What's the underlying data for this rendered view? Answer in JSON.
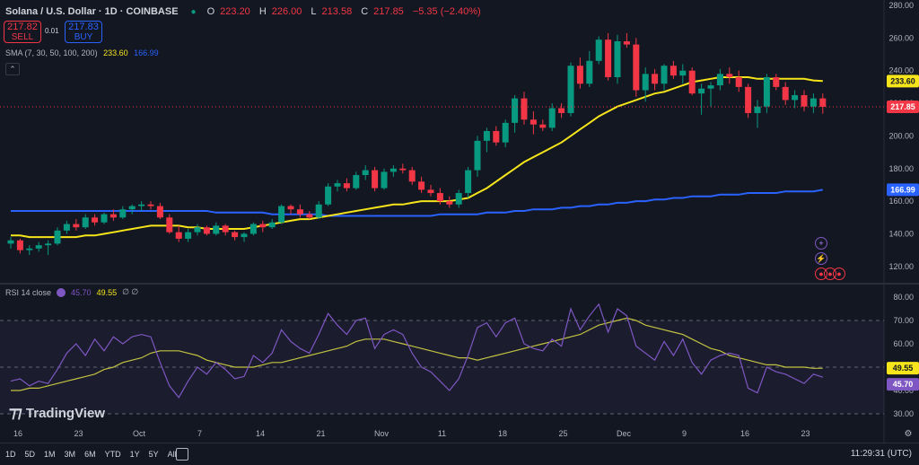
{
  "header": {
    "symbol": "Solana / U.S. Dollar · 1D · COINBASE",
    "open_label": "O",
    "open": "223.20",
    "high_label": "H",
    "high": "226.00",
    "low_label": "L",
    "low": "213.58",
    "close_label": "C",
    "close": "217.85",
    "change": "−5.35 (−2.40%)"
  },
  "trade": {
    "sell_price": "217.82",
    "sell_label": "SELL",
    "spread": "0.01",
    "buy_price": "217.83",
    "buy_label": "BUY"
  },
  "sma_legend": {
    "label": "SMA (7, 30, 50, 100, 200)",
    "v1": "233.60",
    "v2": "166.99"
  },
  "rsi_legend": {
    "label": "RSI 14 close",
    "v1": "45.70",
    "v2": "49.55",
    "extra": "∅ ∅"
  },
  "brand": "TradingView",
  "periods": [
    "1D",
    "5D",
    "1M",
    "3M",
    "6M",
    "YTD",
    "1Y",
    "5Y",
    "All"
  ],
  "clock": "11:29:31 (UTC)",
  "colors": {
    "bg": "#131722",
    "up": "#089981",
    "down": "#f23645",
    "sma_fast": "#f5e51a",
    "sma_slow": "#2962ff",
    "rsi": "#7e57c2",
    "rsi_ma": "#c3c341"
  },
  "chart_data": [
    {
      "type": "candlestick",
      "title": "Solana / U.S. Dollar · 1D · COINBASE",
      "ylim": [
        110,
        280
      ],
      "y_ticks": [
        120,
        140,
        160,
        180,
        200,
        220,
        240,
        260,
        280
      ],
      "x_tick_labels": [
        "16",
        "23",
        "Oct",
        "7",
        "14",
        "21",
        "Nov",
        "11",
        "18",
        "25",
        "Dec",
        "9",
        "16",
        "23"
      ],
      "candles": [
        [
          134,
          138,
          131,
          136
        ],
        [
          136,
          137,
          128,
          130
        ],
        [
          130,
          133,
          127,
          131
        ],
        [
          131,
          135,
          129,
          133
        ],
        [
          133,
          136,
          127,
          134
        ],
        [
          134,
          144,
          133,
          142
        ],
        [
          142,
          148,
          140,
          146
        ],
        [
          146,
          149,
          142,
          144
        ],
        [
          144,
          152,
          143,
          150
        ],
        [
          150,
          152,
          145,
          147
        ],
        [
          147,
          153,
          146,
          152
        ],
        [
          152,
          155,
          148,
          150
        ],
        [
          150,
          157,
          149,
          155
        ],
        [
          155,
          158,
          152,
          157
        ],
        [
          157,
          160,
          154,
          158
        ],
        [
          158,
          160,
          155,
          157
        ],
        [
          157,
          159,
          149,
          150
        ],
        [
          150,
          152,
          140,
          141
        ],
        [
          141,
          145,
          135,
          137
        ],
        [
          137,
          143,
          135,
          141
        ],
        [
          141,
          146,
          139,
          144
        ],
        [
          144,
          145,
          139,
          140
        ],
        [
          140,
          147,
          139,
          145
        ],
        [
          145,
          146,
          139,
          141
        ],
        [
          141,
          142,
          136,
          138
        ],
        [
          138,
          141,
          135,
          140
        ],
        [
          140,
          147,
          139,
          146
        ],
        [
          146,
          148,
          141,
          144
        ],
        [
          144,
          149,
          143,
          147
        ],
        [
          147,
          158,
          146,
          157
        ],
        [
          157,
          158,
          152,
          155
        ],
        [
          155,
          158,
          150,
          152
        ],
        [
          152,
          154,
          149,
          150
        ],
        [
          150,
          160,
          149,
          158
        ],
        [
          158,
          171,
          157,
          169
        ],
        [
          169,
          173,
          166,
          171
        ],
        [
          171,
          174,
          166,
          168
        ],
        [
          168,
          178,
          167,
          176
        ],
        [
          176,
          182,
          173,
          179
        ],
        [
          179,
          181,
          166,
          168
        ],
        [
          168,
          180,
          167,
          178
        ],
        [
          178,
          182,
          175,
          180
        ],
        [
          180,
          183,
          177,
          179
        ],
        [
          179,
          181,
          170,
          172
        ],
        [
          172,
          175,
          165,
          167
        ],
        [
          167,
          170,
          163,
          165
        ],
        [
          165,
          168,
          158,
          160
        ],
        [
          160,
          163,
          156,
          158
        ],
        [
          158,
          167,
          156,
          165
        ],
        [
          165,
          181,
          162,
          179
        ],
        [
          179,
          200,
          175,
          197
        ],
        [
          197,
          205,
          190,
          203
        ],
        [
          203,
          206,
          194,
          196
        ],
        [
          196,
          210,
          193,
          208
        ],
        [
          208,
          225,
          202,
          223
        ],
        [
          223,
          227,
          207,
          210
        ],
        [
          210,
          215,
          201,
          207
        ],
        [
          207,
          210,
          203,
          205
        ],
        [
          205,
          220,
          203,
          217
        ],
        [
          217,
          220,
          211,
          214
        ],
        [
          214,
          245,
          212,
          243
        ],
        [
          243,
          248,
          229,
          232
        ],
        [
          232,
          252,
          230,
          246
        ],
        [
          246,
          261,
          244,
          259
        ],
        [
          259,
          263,
          234,
          236
        ],
        [
          236,
          262,
          232,
          258
        ],
        [
          258,
          263,
          254,
          256
        ],
        [
          256,
          260,
          224,
          228
        ],
        [
          228,
          242,
          221,
          238
        ],
        [
          238,
          241,
          228,
          232
        ],
        [
          232,
          244,
          228,
          243
        ],
        [
          243,
          246,
          235,
          237
        ],
        [
          237,
          244,
          232,
          240
        ],
        [
          240,
          242,
          225,
          226
        ],
        [
          226,
          232,
          213,
          229
        ],
        [
          229,
          233,
          218,
          231
        ],
        [
          231,
          241,
          228,
          238
        ],
        [
          238,
          242,
          232,
          236
        ],
        [
          236,
          240,
          227,
          230
        ],
        [
          230,
          232,
          211,
          214
        ],
        [
          214,
          222,
          205,
          218
        ],
        [
          218,
          238,
          214,
          236
        ],
        [
          236,
          238,
          228,
          230
        ],
        [
          230,
          233,
          219,
          222
        ],
        [
          222,
          228,
          217,
          225
        ],
        [
          225,
          228,
          215,
          218
        ],
        [
          218,
          226,
          214,
          223
        ],
        [
          223,
          226,
          213.58,
          217.85
        ]
      ],
      "series": [
        {
          "name": "SMA",
          "last": 233.6,
          "values": [
            139,
            139,
            138,
            138,
            138,
            138,
            138,
            138,
            139,
            139,
            140,
            141,
            142,
            143,
            144,
            145,
            145,
            145,
            145,
            144,
            144,
            143,
            143,
            143,
            143,
            143,
            144,
            145,
            146,
            147,
            148,
            149,
            149,
            150,
            151,
            152,
            153,
            154,
            155,
            156,
            157,
            158,
            158,
            159,
            160,
            160,
            160,
            160,
            161,
            162,
            165,
            168,
            172,
            176,
            180,
            184,
            187,
            190,
            193,
            196,
            200,
            204,
            208,
            212,
            215,
            218,
            220,
            222,
            224,
            226,
            227,
            229,
            231,
            233,
            234,
            235,
            236,
            236,
            236,
            236,
            235,
            235,
            235,
            235,
            235,
            235,
            234,
            233.6
          ]
        },
        {
          "name": "SMA",
          "last": 166.99,
          "values": [
            154,
            154,
            154,
            154,
            154,
            154,
            154,
            154,
            154,
            154,
            154,
            154,
            154,
            154,
            154,
            154,
            154,
            154,
            154,
            154,
            154,
            154,
            153,
            153,
            153,
            153,
            153,
            153,
            152,
            152,
            152,
            152,
            152,
            152,
            151,
            151,
            151,
            151,
            151,
            151,
            151,
            151,
            151,
            151,
            151,
            151,
            152,
            152,
            152,
            152,
            152,
            153,
            153,
            153,
            154,
            154,
            155,
            155,
            155,
            156,
            156,
            157,
            157,
            158,
            158,
            159,
            159,
            160,
            160,
            161,
            161,
            162,
            162,
            163,
            163,
            163,
            164,
            164,
            164,
            165,
            165,
            165,
            165,
            166,
            166,
            166,
            166,
            166.99
          ]
        }
      ],
      "price_labels": [
        "233.60",
        "217.85",
        "166.99"
      ]
    },
    {
      "type": "line",
      "title": "RSI 14 close",
      "ylim": [
        25,
        85
      ],
      "y_ticks": [
        30,
        40,
        50,
        60,
        70,
        80
      ],
      "bands": [
        30,
        50,
        70
      ],
      "series": [
        {
          "name": "RSI",
          "last": 45.7,
          "values": [
            44,
            45,
            42,
            44,
            43,
            49,
            56,
            60,
            55,
            62,
            57,
            63,
            60,
            63,
            64,
            63,
            52,
            42,
            37,
            44,
            50,
            47,
            52,
            49,
            45,
            46,
            55,
            52,
            56,
            66,
            61,
            58,
            56,
            64,
            73,
            68,
            64,
            70,
            71,
            58,
            64,
            66,
            64,
            56,
            50,
            48,
            44,
            40,
            45,
            55,
            67,
            69,
            63,
            69,
            71,
            60,
            58,
            57,
            62,
            59,
            75,
            66,
            72,
            77,
            65,
            75,
            72,
            59,
            56,
            53,
            61,
            55,
            62,
            52,
            47,
            53,
            55,
            56,
            55,
            41,
            39,
            50,
            48,
            47,
            45,
            43,
            47,
            45.7
          ]
        },
        {
          "name": "RSI MA",
          "last": 49.55,
          "values": [
            40,
            40,
            41,
            41,
            42,
            43,
            44,
            45,
            46,
            47,
            49,
            50,
            52,
            53,
            54,
            56,
            57,
            57,
            57,
            56,
            55,
            53,
            52,
            51,
            50,
            50,
            50,
            51,
            52,
            52,
            53,
            54,
            55,
            56,
            57,
            58,
            59,
            61,
            62,
            62,
            62,
            61,
            60,
            59,
            58,
            57,
            56,
            55,
            54,
            54,
            53,
            54,
            55,
            56,
            57,
            58,
            59,
            60,
            61,
            62,
            63,
            64,
            66,
            68,
            69,
            70,
            71,
            70,
            68,
            67,
            66,
            65,
            64,
            62,
            60,
            58,
            57,
            55,
            54,
            53,
            52,
            51,
            51,
            50,
            50,
            50,
            49.5,
            49.55
          ]
        }
      ],
      "price_labels": [
        "49.55",
        "45.70"
      ]
    }
  ]
}
